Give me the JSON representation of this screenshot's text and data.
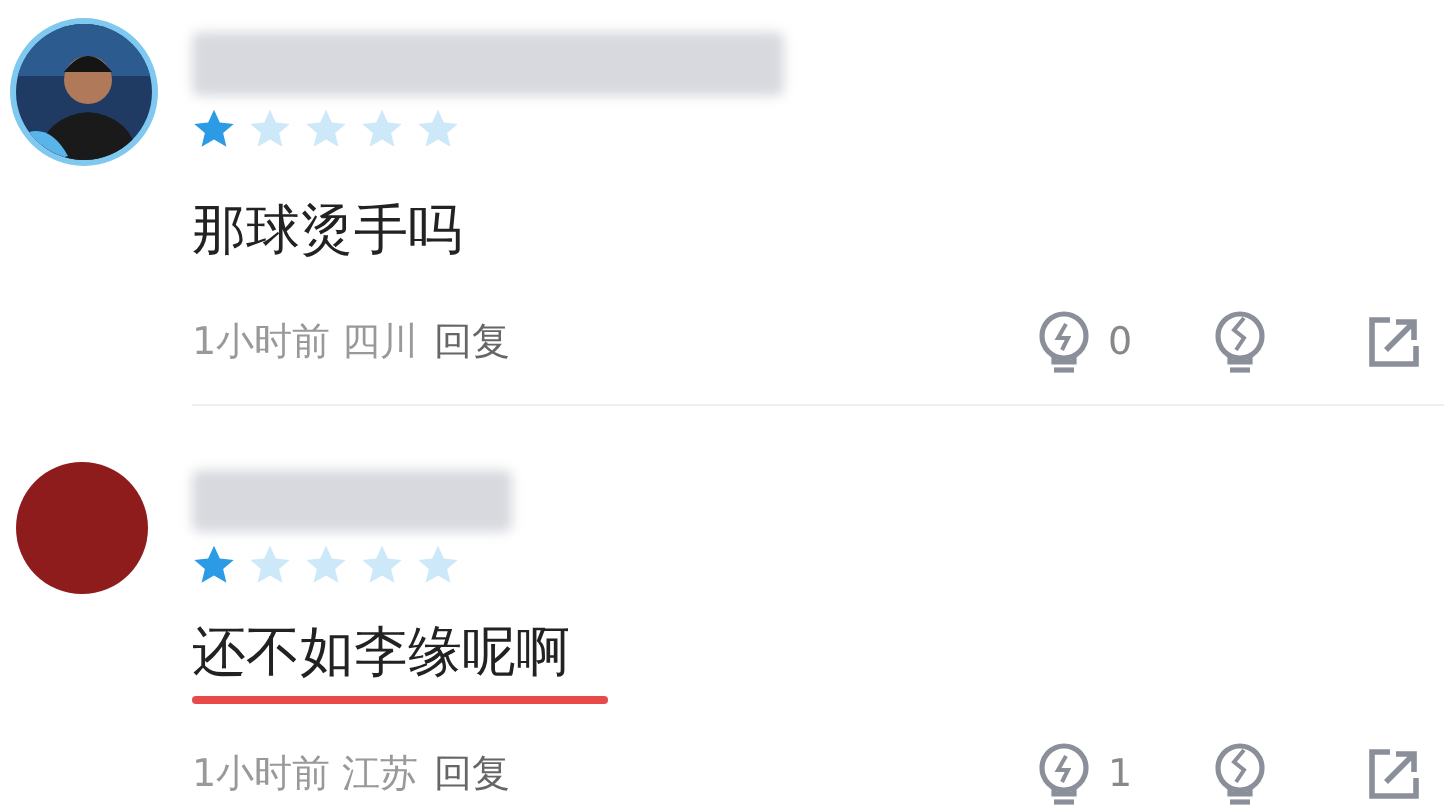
{
  "comments": [
    {
      "stars": 1,
      "text": "那球烫手吗",
      "underlined": false,
      "time": "1小时前",
      "location": "四川",
      "reply": "回复",
      "likes": "0"
    },
    {
      "avatar": {
        "kind": "plain"
      },
      "stars": 1,
      "text": "还不如李缘呢啊",
      "underlined": true,
      "time": "1小时前",
      "location": "江苏",
      "reply": "回复",
      "likes": "1"
    }
  ]
}
